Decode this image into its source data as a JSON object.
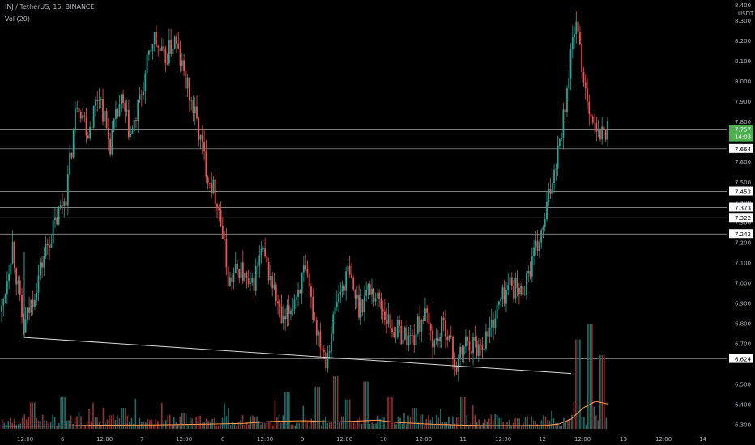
{
  "symbol": {
    "title": "INJ / TetherUS, 15, BINANCE",
    "indicator": "Vol (20)"
  },
  "price_axis": {
    "currency": "USDT",
    "top_label": "8.400"
  },
  "colors": {
    "background": "#000000",
    "candle_up": "#26a69a",
    "candle_down": "#ef5350",
    "volume_up": "#1f6f68",
    "volume_down": "#8e3330",
    "volume_ma": "#ff9d57",
    "level_line": "#c8c8c8",
    "trendline": "#d8d8d8",
    "axis_text": "#b2b5be",
    "current_price_badge": "#4caf50"
  },
  "chart_data": {
    "type": "candlestick",
    "ylim": [
      6.27,
      8.4
    ],
    "y_ticks": [
      "8.300",
      "8.200",
      "8.100",
      "8.000",
      "7.900",
      "7.800",
      "7.600",
      "7.500",
      "7.400",
      "7.300",
      "7.200",
      "7.100",
      "7.000",
      "6.900",
      "6.800",
      "6.700",
      "6.500",
      "6.400",
      "6.300"
    ],
    "x_ticks": [
      "12:00",
      "6",
      "12:00",
      "7",
      "12:00",
      "8",
      "12:00",
      "9",
      "12:00",
      "10",
      "12:00",
      "11",
      "12:00",
      "12",
      "12:00",
      "13",
      "12:00",
      "14"
    ],
    "close_path": [
      [
        6.86,
        6.88
      ],
      [
        7.2,
        7.22
      ],
      [
        6.76,
        6.8
      ],
      [
        6.95,
        6.9
      ],
      [
        7.15,
        7.1
      ],
      [
        7.3,
        7.35
      ],
      [
        7.45,
        7.5
      ],
      [
        7.92,
        7.95
      ],
      [
        7.75,
        7.8
      ],
      [
        7.95,
        7.9
      ],
      [
        7.68,
        7.72
      ],
      [
        7.9,
        7.95
      ],
      [
        7.72,
        7.78
      ],
      [
        7.95,
        8.0
      ],
      [
        8.22,
        8.2
      ],
      [
        8.1,
        8.05
      ],
      [
        8.2,
        8.15
      ],
      [
        8.0,
        8.05
      ],
      [
        7.8,
        7.85
      ],
      [
        7.55,
        7.6
      ],
      [
        7.4,
        7.45
      ],
      [
        7.0,
        7.05
      ],
      [
        7.08,
        7.1
      ],
      [
        6.95,
        7.0
      ],
      [
        7.15,
        7.2
      ],
      [
        7.0,
        7.05
      ],
      [
        6.78,
        6.82
      ],
      [
        6.92,
        6.95
      ],
      [
        7.05,
        7.0
      ],
      [
        6.8,
        6.85
      ],
      [
        6.63,
        6.65
      ],
      [
        6.92,
        6.9
      ],
      [
        7.05,
        7.0
      ],
      [
        6.88,
        6.9
      ],
      [
        6.98,
        6.95
      ],
      [
        6.9,
        6.88
      ],
      [
        6.78,
        6.75
      ],
      [
        6.75,
        6.72
      ],
      [
        6.72,
        6.7
      ],
      [
        6.85,
        6.88
      ],
      [
        6.7,
        6.72
      ],
      [
        6.8,
        6.78
      ],
      [
        6.58,
        6.6
      ],
      [
        6.72,
        6.7
      ],
      [
        6.68,
        6.7
      ],
      [
        6.75,
        6.78
      ],
      [
        6.9,
        6.95
      ],
      [
        7.0,
        6.98
      ],
      [
        6.95,
        6.98
      ],
      [
        7.1,
        7.15
      ],
      [
        7.25,
        7.3
      ],
      [
        7.55,
        7.6
      ],
      [
        7.85,
        7.9
      ],
      [
        8.3,
        8.2
      ],
      [
        7.95,
        7.9
      ],
      [
        7.72,
        7.7
      ],
      [
        7.76,
        7.75
      ]
    ],
    "price_levels": [
      "7.757",
      "7.664",
      "7.453",
      "7.373",
      "7.322",
      "7.242",
      "6.624"
    ],
    "current_price": "7.757",
    "current_countdown": "14:03",
    "trendline": {
      "start": [
        0.0,
        6.73
      ],
      "end": [
        0.904,
        6.552
      ]
    },
    "volume_ma_path": [
      [
        0,
        0.03
      ],
      [
        0.1,
        0.035
      ],
      [
        0.15,
        0.06
      ],
      [
        0.25,
        0.07
      ],
      [
        0.33,
        0.09
      ],
      [
        0.4,
        0.12
      ],
      [
        0.45,
        0.18
      ],
      [
        0.5,
        0.2
      ],
      [
        0.55,
        0.16
      ],
      [
        0.6,
        0.2
      ],
      [
        0.62,
        0.22
      ],
      [
        0.65,
        0.15
      ],
      [
        0.7,
        0.1
      ],
      [
        0.75,
        0.07
      ],
      [
        0.8,
        0.05
      ],
      [
        0.85,
        0.05
      ],
      [
        0.9,
        0.06
      ],
      [
        0.92,
        0.1
      ],
      [
        0.94,
        0.25
      ],
      [
        0.96,
        0.6
      ],
      [
        0.98,
        0.8
      ],
      [
        1.0,
        0.72
      ]
    ],
    "volume_spikes": [
      [
        0.05,
        0.25
      ],
      [
        0.1,
        0.3
      ],
      [
        0.2,
        0.2
      ],
      [
        0.3,
        0.15
      ],
      [
        0.47,
        0.35
      ],
      [
        0.52,
        0.4
      ],
      [
        0.55,
        0.5
      ],
      [
        0.57,
        0.28
      ],
      [
        0.6,
        0.45
      ],
      [
        0.64,
        0.3
      ],
      [
        0.68,
        0.2
      ],
      [
        0.76,
        0.3
      ],
      [
        0.95,
        0.85
      ],
      [
        0.97,
        1.0
      ],
      [
        0.99,
        0.7
      ]
    ]
  }
}
